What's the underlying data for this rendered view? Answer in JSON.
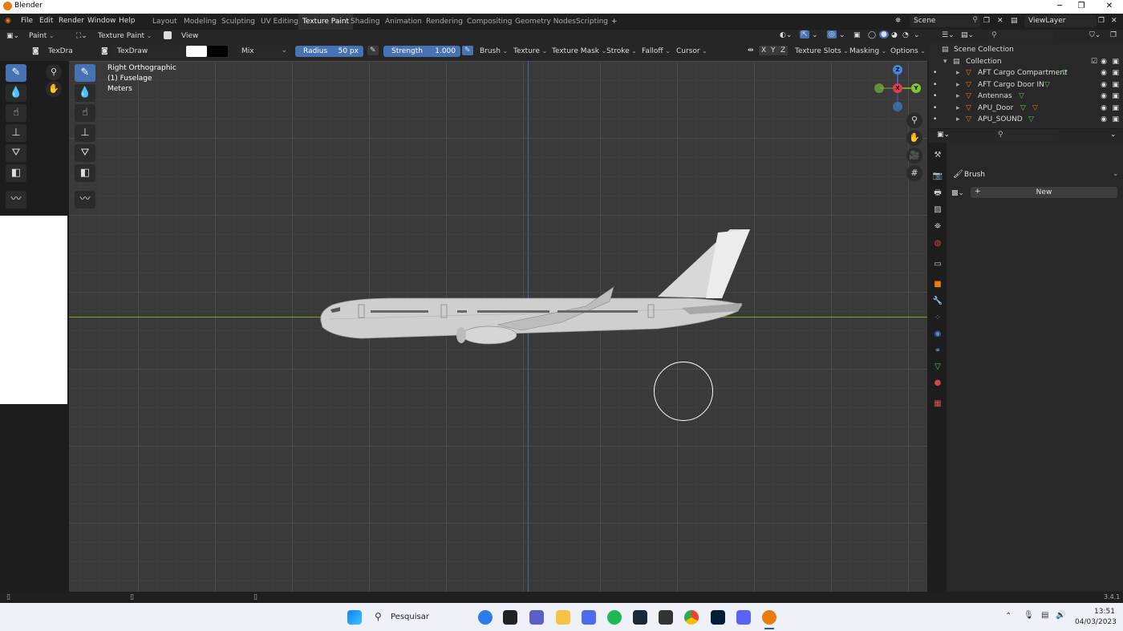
{
  "window": {
    "title": "Blender"
  },
  "menu": {
    "file": "File",
    "edit": "Edit",
    "render": "Render",
    "window": "Window",
    "help": "Help"
  },
  "workspaces": [
    "Layout",
    "Modeling",
    "Sculpting",
    "UV Editing",
    "Texture Paint",
    "Shading",
    "Animation",
    "Rendering",
    "Compositing",
    "Geometry Nodes",
    "Scripting"
  ],
  "active_workspace": "Texture Paint",
  "scene": {
    "name": "Scene",
    "view_layer": "ViewLayer"
  },
  "image_editor": {
    "mode": "Paint",
    "image_name": "TexDra"
  },
  "viewport_header": {
    "mode": "Texture Paint",
    "view": "View"
  },
  "tool_header": {
    "brush_name": "TexDraw",
    "blend": "Mix",
    "radius_label": "Radius",
    "radius_value": "50 px",
    "strength_label": "Strength",
    "strength_value": "1.000",
    "brush": "Brush",
    "texture": "Texture",
    "texture_mask": "Texture Mask",
    "stroke": "Stroke",
    "falloff": "Falloff",
    "cursor": "Cursor",
    "axis_x": "X",
    "axis_y": "Y",
    "axis_z": "Z",
    "texture_slots": "Texture Slots",
    "masking": "Masking",
    "options": "Options"
  },
  "viewport_info": {
    "view": "Right Orthographic",
    "object": "(1) Fuselage",
    "units": "Meters"
  },
  "gizmo": {
    "z": "Z",
    "x": "X",
    "y": "Y"
  },
  "outliner": {
    "root": "Scene Collection",
    "collection": "Collection",
    "items": [
      "AFT Cargo Compartment",
      "AFT Cargo Door IN",
      "Antennas",
      "APU_Door",
      "APU_SOUND"
    ]
  },
  "properties": {
    "panel": "Brush",
    "new_button": "New"
  },
  "status": {
    "version": "3.4.1"
  },
  "taskbar": {
    "search": "Pesquisar",
    "time": "13:51",
    "date": "04/03/2023"
  },
  "colors": {
    "accent": "#4772b3",
    "object_orange": "#e87d0d",
    "x_axis": "#7aa61f",
    "z_axis": "#3d64b5"
  }
}
